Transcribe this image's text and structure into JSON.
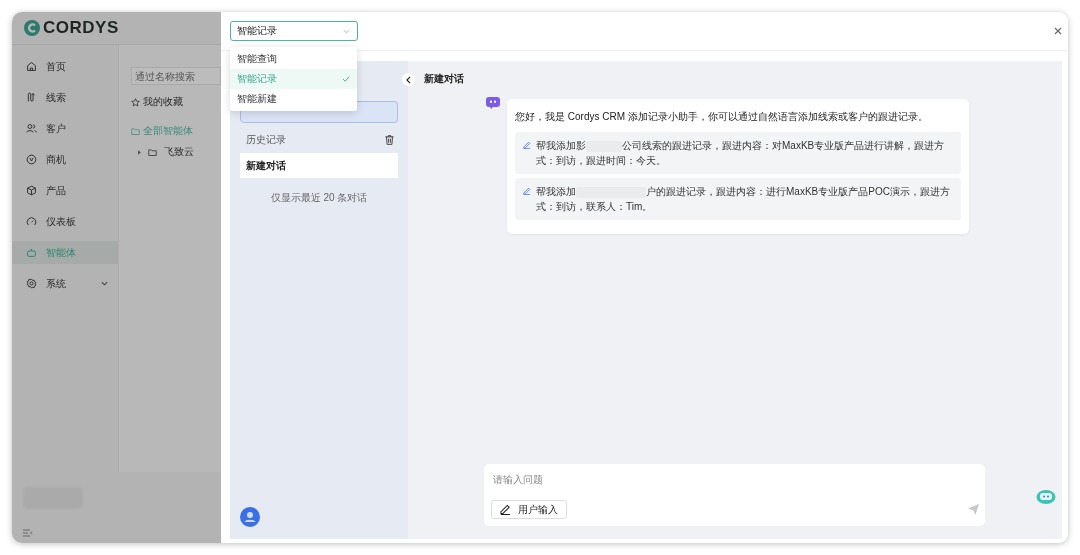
{
  "app": {
    "logo": "CORDYS",
    "nav": [
      {
        "label": "首页",
        "selected": false,
        "expandable": false
      },
      {
        "label": "线索",
        "selected": false,
        "expandable": false
      },
      {
        "label": "客户",
        "selected": false,
        "expandable": false
      },
      {
        "label": "商机",
        "selected": false,
        "expandable": false
      },
      {
        "label": "产品",
        "selected": false,
        "expandable": false
      },
      {
        "label": "仪表板",
        "selected": false,
        "expandable": false
      },
      {
        "label": "智能体",
        "selected": true,
        "expandable": false
      },
      {
        "label": "系统",
        "selected": false,
        "expandable": true
      }
    ],
    "agent_list": {
      "search": {
        "placeholder": "通过名称搜索"
      },
      "items": [
        {
          "label": "我的收藏",
          "kind": "favorite",
          "selected": false
        },
        {
          "label": "全部智能体",
          "kind": "folder",
          "selected": true
        },
        {
          "label": "飞致云",
          "kind": "group",
          "selected": false
        }
      ]
    }
  },
  "drawer": {
    "select": {
      "value": "智能记录"
    },
    "options": [
      {
        "label": "智能查询",
        "selected": false
      },
      {
        "label": "智能记录",
        "selected": true
      },
      {
        "label": "智能新建",
        "selected": false
      }
    ],
    "history": {
      "title": "历史记录",
      "items": [
        {
          "label": "新建对话",
          "selected": true
        }
      ],
      "note": "仅显示最近 20 条对话"
    },
    "chat": {
      "title": "新建对话",
      "greeting": "您好，我是 Cordys CRM 添加记录小助手，你可以通过自然语言添加线索或客户的跟进记录。",
      "suggestions": [
        {
          "before": "帮我添加影",
          "after": "公司线索的跟进记录，跟进内容：对MaxKB专业版产品进行讲解，跟进方式：到访，跟进时间：今天。"
        },
        {
          "before": "帮我添加",
          "after": "户的跟进记录，跟进内容：进行MaxKB专业版产品POC演示，跟进方式：到访，联系人：Tim。"
        }
      ],
      "input": {
        "placeholder": "请输入问题"
      },
      "mode_button": "用户输入"
    }
  }
}
